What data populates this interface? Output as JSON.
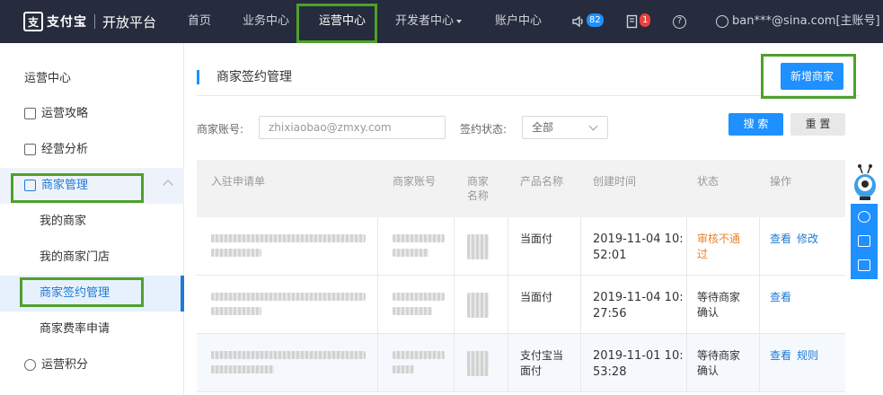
{
  "topbar": {
    "logo_glyph": "支",
    "logo_brand": "支付宝",
    "platform": "开放平台",
    "nav": [
      {
        "label": "首页"
      },
      {
        "label": "业务中心"
      },
      {
        "label": "运营中心"
      },
      {
        "label": "开发者中心"
      },
      {
        "label": "账户中心"
      }
    ],
    "notice_count": "82",
    "task_count": "1",
    "help_glyph": "?",
    "account": "ban***@sina.com[主账号]"
  },
  "sidebar": {
    "items": [
      {
        "label": "运营中心"
      },
      {
        "label": "运营攻略"
      },
      {
        "label": "经营分析"
      },
      {
        "label": "商家管理"
      },
      {
        "label": "我的商家"
      },
      {
        "label": "我的商家门店"
      },
      {
        "label": "商家签约管理"
      },
      {
        "label": "商家费率申请"
      },
      {
        "label": "运营积分"
      }
    ]
  },
  "main": {
    "title": "商家签约管理",
    "add_button": "新增商家",
    "filters": {
      "account_label": "商家账号:",
      "account_placeholder": "zhixiaobao@zmxy.com",
      "status_label": "签约状态:",
      "status_value": "全部",
      "search_button": "搜 索",
      "reset_button": "重 置"
    },
    "table": {
      "headers": [
        "入驻申请单",
        "商家账号",
        "商家名称",
        "产品名称",
        "创建时间",
        "状态",
        "操作"
      ],
      "rows": [
        {
          "product": "当面付",
          "created_line1": "2019-11-04 10:",
          "created_line2": "52:01",
          "status_line1": "审核不通",
          "status_line2": "过",
          "actions": [
            "查看",
            "修改"
          ]
        },
        {
          "product": "当面付",
          "created_line1": "2019-11-04 10:",
          "created_line2": "27:56",
          "status_line1": "等待商家",
          "status_line2": "确认",
          "actions": [
            "查看"
          ]
        },
        {
          "product_line1": "支付宝当",
          "product_line2": "面付",
          "created_line1": "2019-11-01 10:",
          "created_line2": "53:28",
          "status_line1": "等待商家",
          "status_line2": "确认",
          "actions": [
            "查看",
            "规则"
          ]
        }
      ]
    }
  },
  "colors": {
    "topbar": "#262b3d",
    "accent": "#1e90ff",
    "warn": "#e8822a",
    "highlight_box": "#4ea12b"
  }
}
